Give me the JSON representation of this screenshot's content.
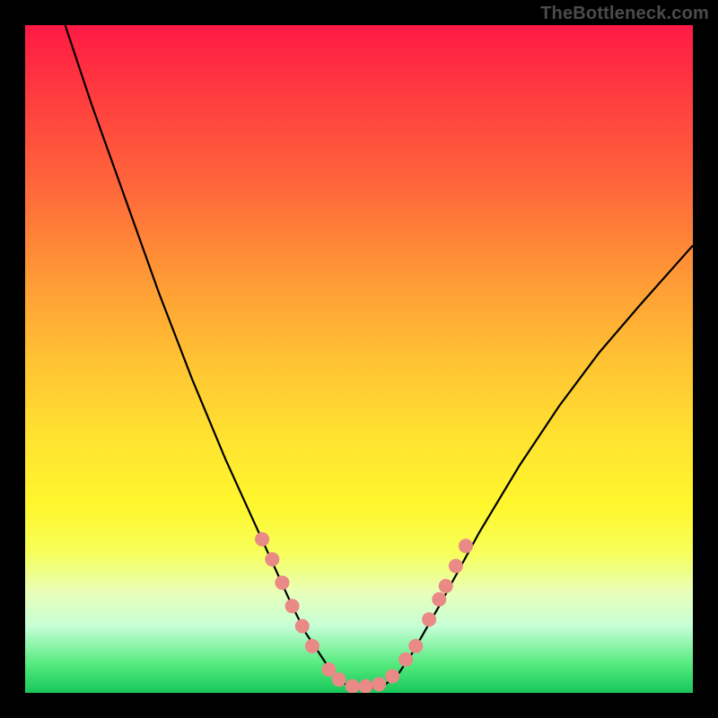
{
  "watermark": "TheBottleneck.com",
  "chart_data": {
    "type": "line",
    "title": "",
    "xlabel": "",
    "ylabel": "",
    "xlim": [
      0,
      100
    ],
    "ylim": [
      0,
      100
    ],
    "grid": false,
    "series": [
      {
        "name": "bottleneck-curve",
        "x": [
          6,
          10,
          15,
          20,
          25,
          30,
          35,
          40,
          42,
          44,
          46,
          48,
          50,
          52,
          54,
          56,
          58,
          62,
          68,
          74,
          80,
          86,
          92,
          100
        ],
        "y": [
          100,
          88,
          74,
          60,
          47,
          35,
          24,
          13,
          9,
          6,
          3,
          1.3,
          0.8,
          0.8,
          1.3,
          3,
          6,
          13,
          24,
          34,
          43,
          51,
          58,
          67
        ],
        "color": "#000000"
      }
    ],
    "markers": {
      "name": "highlight-dots",
      "color": "#e98a86",
      "radius_px": 8,
      "points_xy": [
        [
          35.5,
          23
        ],
        [
          37,
          20
        ],
        [
          38.5,
          16.5
        ],
        [
          40,
          13
        ],
        [
          41.5,
          10
        ],
        [
          43,
          7
        ],
        [
          45.5,
          3.5
        ],
        [
          47,
          2
        ],
        [
          49,
          1
        ],
        [
          51,
          1
        ],
        [
          53,
          1.3
        ],
        [
          55,
          2.5
        ],
        [
          57,
          5
        ],
        [
          58.5,
          7
        ],
        [
          60.5,
          11
        ],
        [
          62,
          14
        ],
        [
          63,
          16
        ],
        [
          64.5,
          19
        ],
        [
          66,
          22
        ]
      ]
    },
    "background_gradient": {
      "top": "#ff1a44",
      "upper_mid": "#ffc233",
      "lower_mid": "#fff72d",
      "bottom": "#18c65a"
    }
  }
}
